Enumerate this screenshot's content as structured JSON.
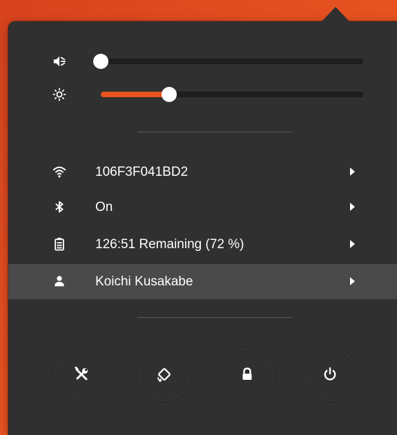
{
  "status_menu": {
    "volume": {
      "icon": "audio-volume-muted-icon",
      "level_percent": 0
    },
    "brightness": {
      "icon": "display-brightness-icon",
      "level_percent": 26
    },
    "items": [
      {
        "id": "wifi",
        "icon": "wifi-icon",
        "label": "106F3F041BD2"
      },
      {
        "id": "bluetooth",
        "icon": "bluetooth-icon",
        "label": "On"
      },
      {
        "id": "battery",
        "icon": "battery-icon",
        "label": "126:51 Remaining (72 %)"
      },
      {
        "id": "user",
        "icon": "user-icon",
        "label": "Koichi Kusakabe",
        "selected": true
      }
    ],
    "system_buttons": [
      {
        "id": "settings",
        "icon": "settings-tools-icon"
      },
      {
        "id": "orientation-lock",
        "icon": "rotation-lock-icon"
      },
      {
        "id": "lock",
        "icon": "lock-icon"
      },
      {
        "id": "power",
        "icon": "power-icon"
      }
    ]
  },
  "colors": {
    "accent": "#E95420",
    "menu_background": "#303030",
    "selected_row": "#4A4A4A",
    "track": "#1F1F1F",
    "separator": "#595959",
    "text": "#FFFFFF"
  }
}
